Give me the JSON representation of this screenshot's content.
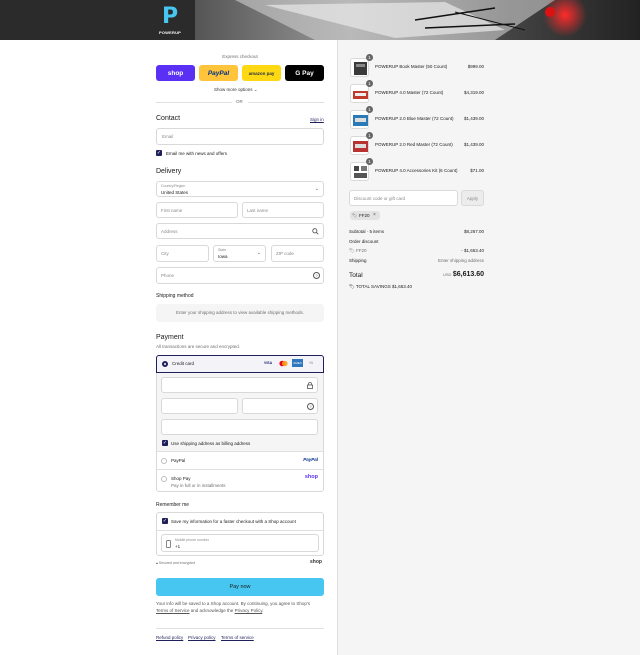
{
  "brand": {
    "name": "POWERUP",
    "logo_letter": "P"
  },
  "express": {
    "title": "Express checkout",
    "buttons": [
      {
        "label": "shop",
        "bg": "#5a31f4",
        "fg": "#ffffff"
      },
      {
        "label": "PayPal",
        "bg": "#ffc439",
        "fg": "#003087"
      },
      {
        "label": "amazon pay",
        "bg": "#ffd814",
        "fg": "#232f3e"
      },
      {
        "label": "G Pay",
        "bg": "#000000",
        "fg": "#ffffff"
      }
    ],
    "show_more": "Show more options",
    "or": "OR"
  },
  "contact": {
    "title": "Contact",
    "sign_in": "Sign in",
    "email_placeholder": "Email",
    "news_label": "Email me with news and offers"
  },
  "delivery": {
    "title": "Delivery",
    "country_label": "Country/Region",
    "country_value": "United States",
    "first_name": "First name",
    "last_name": "Last name",
    "address": "Address",
    "city": "City",
    "state_label": "State",
    "state_value": "Iowa",
    "zip": "ZIP code",
    "phone": "Phone"
  },
  "shipping": {
    "title": "Shipping method",
    "placeholder": "Enter your shipping address to view available shipping methods."
  },
  "payment": {
    "title": "Payment",
    "subtitle": "All transactions are secure and encrypted.",
    "credit_card": "Credit card",
    "card_badges": [
      "VISA",
      "MC",
      "AMEX",
      "+1"
    ],
    "billing_label": "Use shipping address as billing address",
    "paypal": "PayPal",
    "paypal_logo": "PayPal",
    "shop_pay": "Shop Pay",
    "shop_pay_sub": "Pay in full or in installments",
    "shop_pay_logo": "shop"
  },
  "remember": {
    "title": "Remember me",
    "save_label": "Save my information for a faster checkout with a Shop account",
    "phone_label": "Mobile phone number",
    "phone_value": "+1",
    "secure": "Secured and encrypted",
    "shop_logo": "shop"
  },
  "pay_now": "Pay now",
  "legal": {
    "line1": "Your info will be saved to a Shop account. By continuing, you agree to Shop's",
    "terms": "Terms of Service",
    "and": "and acknowledge the",
    "privacy": "Privacy Policy",
    "end": "."
  },
  "footer_links": [
    "Refund policy",
    "Privacy policy",
    "Terms of service"
  ],
  "cart": {
    "items": [
      {
        "name": "POWERUP Book Master (50 Count)",
        "price": "$999.00",
        "qty": "1"
      },
      {
        "name": "POWERUP 4.0 Master (72 Count)",
        "price": "$4,319.00",
        "qty": "1"
      },
      {
        "name": "POWERUP 2.0 Blue Master (72 Count)",
        "price": "$1,439.00",
        "qty": "1"
      },
      {
        "name": "POWERUP 2.0 Red Master (72 Count)",
        "price": "$1,439.00",
        "qty": "1"
      },
      {
        "name": "POWERUP 4.0 Accessories Kit (6 Count)",
        "price": "$71.00",
        "qty": "1"
      }
    ],
    "discount_placeholder": "Discount code or gift card",
    "apply": "Apply",
    "code": "FF20",
    "subtotal_label": "Subtotal · 5 items",
    "subtotal_value": "$8,267.00",
    "order_discount_label": "Order discount",
    "order_discount_code": "FF20",
    "order_discount_value": "- $1,653.40",
    "shipping_label": "Shipping",
    "shipping_value": "Enter shipping address",
    "total_label": "Total",
    "currency": "USD",
    "total_value": "$6,613.60",
    "savings_label": "TOTAL SAVINGS",
    "savings_value": "$1,653.40"
  },
  "colors": {
    "accent": "#47c6f1",
    "checkbox": "#1f1f5c",
    "shop_purple": "#5a31f4"
  }
}
